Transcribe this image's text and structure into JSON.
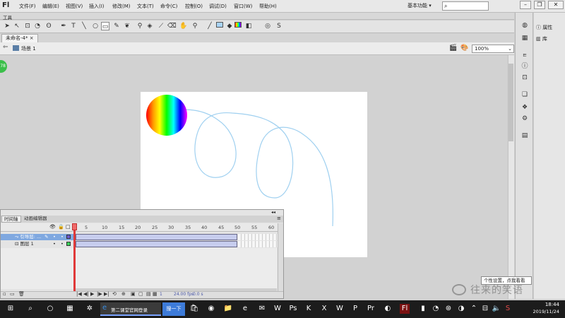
{
  "app": {
    "logo": "Fl",
    "menus": [
      "文件(F)",
      "编辑(E)",
      "视图(V)",
      "插入(I)",
      "修改(M)",
      "文本(T)",
      "命令(C)",
      "控制(O)",
      "调试(D)",
      "窗口(W)",
      "帮助(H)"
    ],
    "workspace": "基本功能 ▾",
    "search_placeholder": ""
  },
  "tools_panel": {
    "label": "工具"
  },
  "document": {
    "tab": "未命名-4*",
    "close": "×"
  },
  "editbar": {
    "scene": "场景 1",
    "zoom": "100%"
  },
  "right_panel": {
    "properties": "属性",
    "library": "库"
  },
  "timeline": {
    "tabs": [
      "时间轴",
      "动画编辑器"
    ],
    "frame_numbers": [
      "5",
      "10",
      "15",
      "20",
      "25",
      "30",
      "35",
      "40",
      "45",
      "50",
      "55",
      "60"
    ],
    "layers": [
      {
        "name": "引导层: ...",
        "selected": true
      },
      {
        "name": "图层 1",
        "selected": false
      }
    ],
    "status_frame": "1",
    "status_fps": "24.00 fps",
    "status_time": "0.0 s"
  },
  "tooltip": "个性设置，点我看看",
  "watermark": "往来的笑语",
  "taskbar": {
    "ie_label": "第二课堂官网登录",
    "search_btn": "搜一下",
    "time": "18:44",
    "date": "2019/11/24"
  },
  "colors": {
    "accent": "#7fa8e0",
    "playhead": "#e03a3a",
    "guide_path": "#9fd0f0",
    "taskbar": "#1c1c1c"
  }
}
